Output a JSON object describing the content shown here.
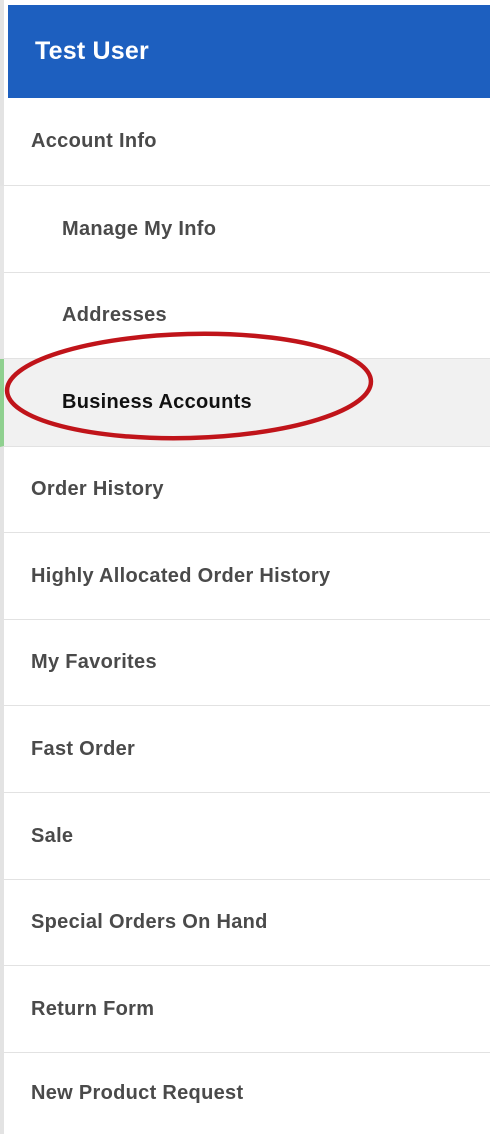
{
  "user": {
    "name": "Test User"
  },
  "menu": {
    "account_info": "Account Info",
    "manage_my_info": "Manage My Info",
    "addresses": "Addresses",
    "business_accounts": "Business Accounts",
    "order_history": "Order History",
    "highly_allocated_order_history": "Highly Allocated Order History",
    "my_favorites": "My Favorites",
    "fast_order": "Fast Order",
    "sale": "Sale",
    "special_orders_on_hand": "Special Orders On Hand",
    "return_form": "Return Form",
    "new_product_request": "New Product Request"
  },
  "colors": {
    "header_bg": "#1d5fbf",
    "active_accent": "#8fd08f",
    "annotation_circle": "#c0141a"
  }
}
